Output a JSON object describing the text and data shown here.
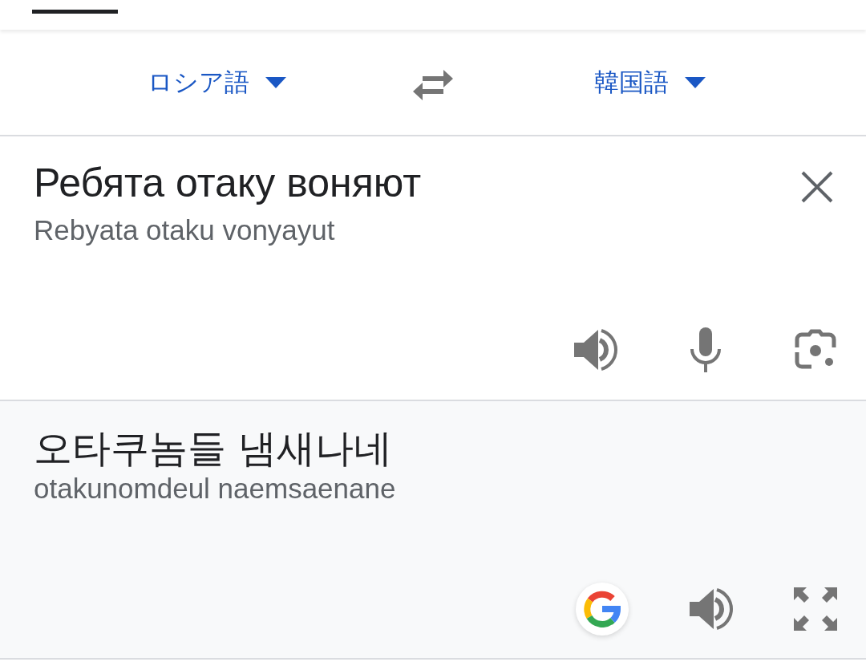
{
  "language_bar": {
    "source_language": "ロシア語",
    "target_language": "韓国語"
  },
  "source": {
    "text": "Ребята отаку воняют",
    "transliteration": "Rebyata otaku vonyayut"
  },
  "result": {
    "text": "오타쿠놈들 냄새나네",
    "romanization": "otakunomdeul naemsaenane"
  }
}
